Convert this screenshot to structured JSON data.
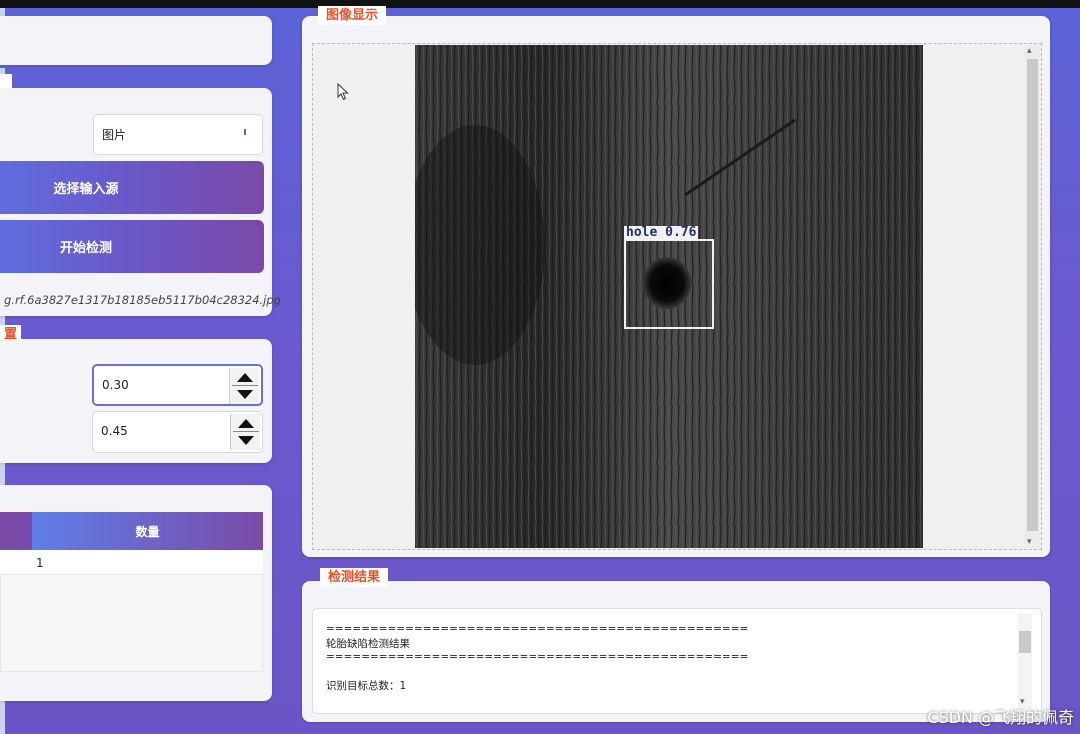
{
  "input_section": {
    "source_type": "图片",
    "select_source_button": "选择输入源",
    "start_detection_button": "开始检测",
    "file_path": "g.rf.6a3827e1317b18185eb5117b04c28324.jpg"
  },
  "params_section": {
    "title_fragment": "置",
    "confidence": "0.30",
    "iou": "0.45"
  },
  "results_table": {
    "columns": [
      "数量"
    ],
    "rows": [
      [
        "1"
      ]
    ]
  },
  "image_display": {
    "title": "图像显示",
    "detection_label": "hole  0.76"
  },
  "detection_results": {
    "title": "检测结果",
    "lines": [
      "================================================",
      "轮胎缺陷检测结果",
      "================================================",
      "",
      "识别目标总数：1"
    ]
  },
  "watermark": "CSDN @飞翔的佩奇",
  "colors": {
    "accent": "#e8522a",
    "button_gradient_start": "#5f6fe0",
    "button_gradient_end": "#7a4aa8",
    "background": "#5a63d6"
  }
}
